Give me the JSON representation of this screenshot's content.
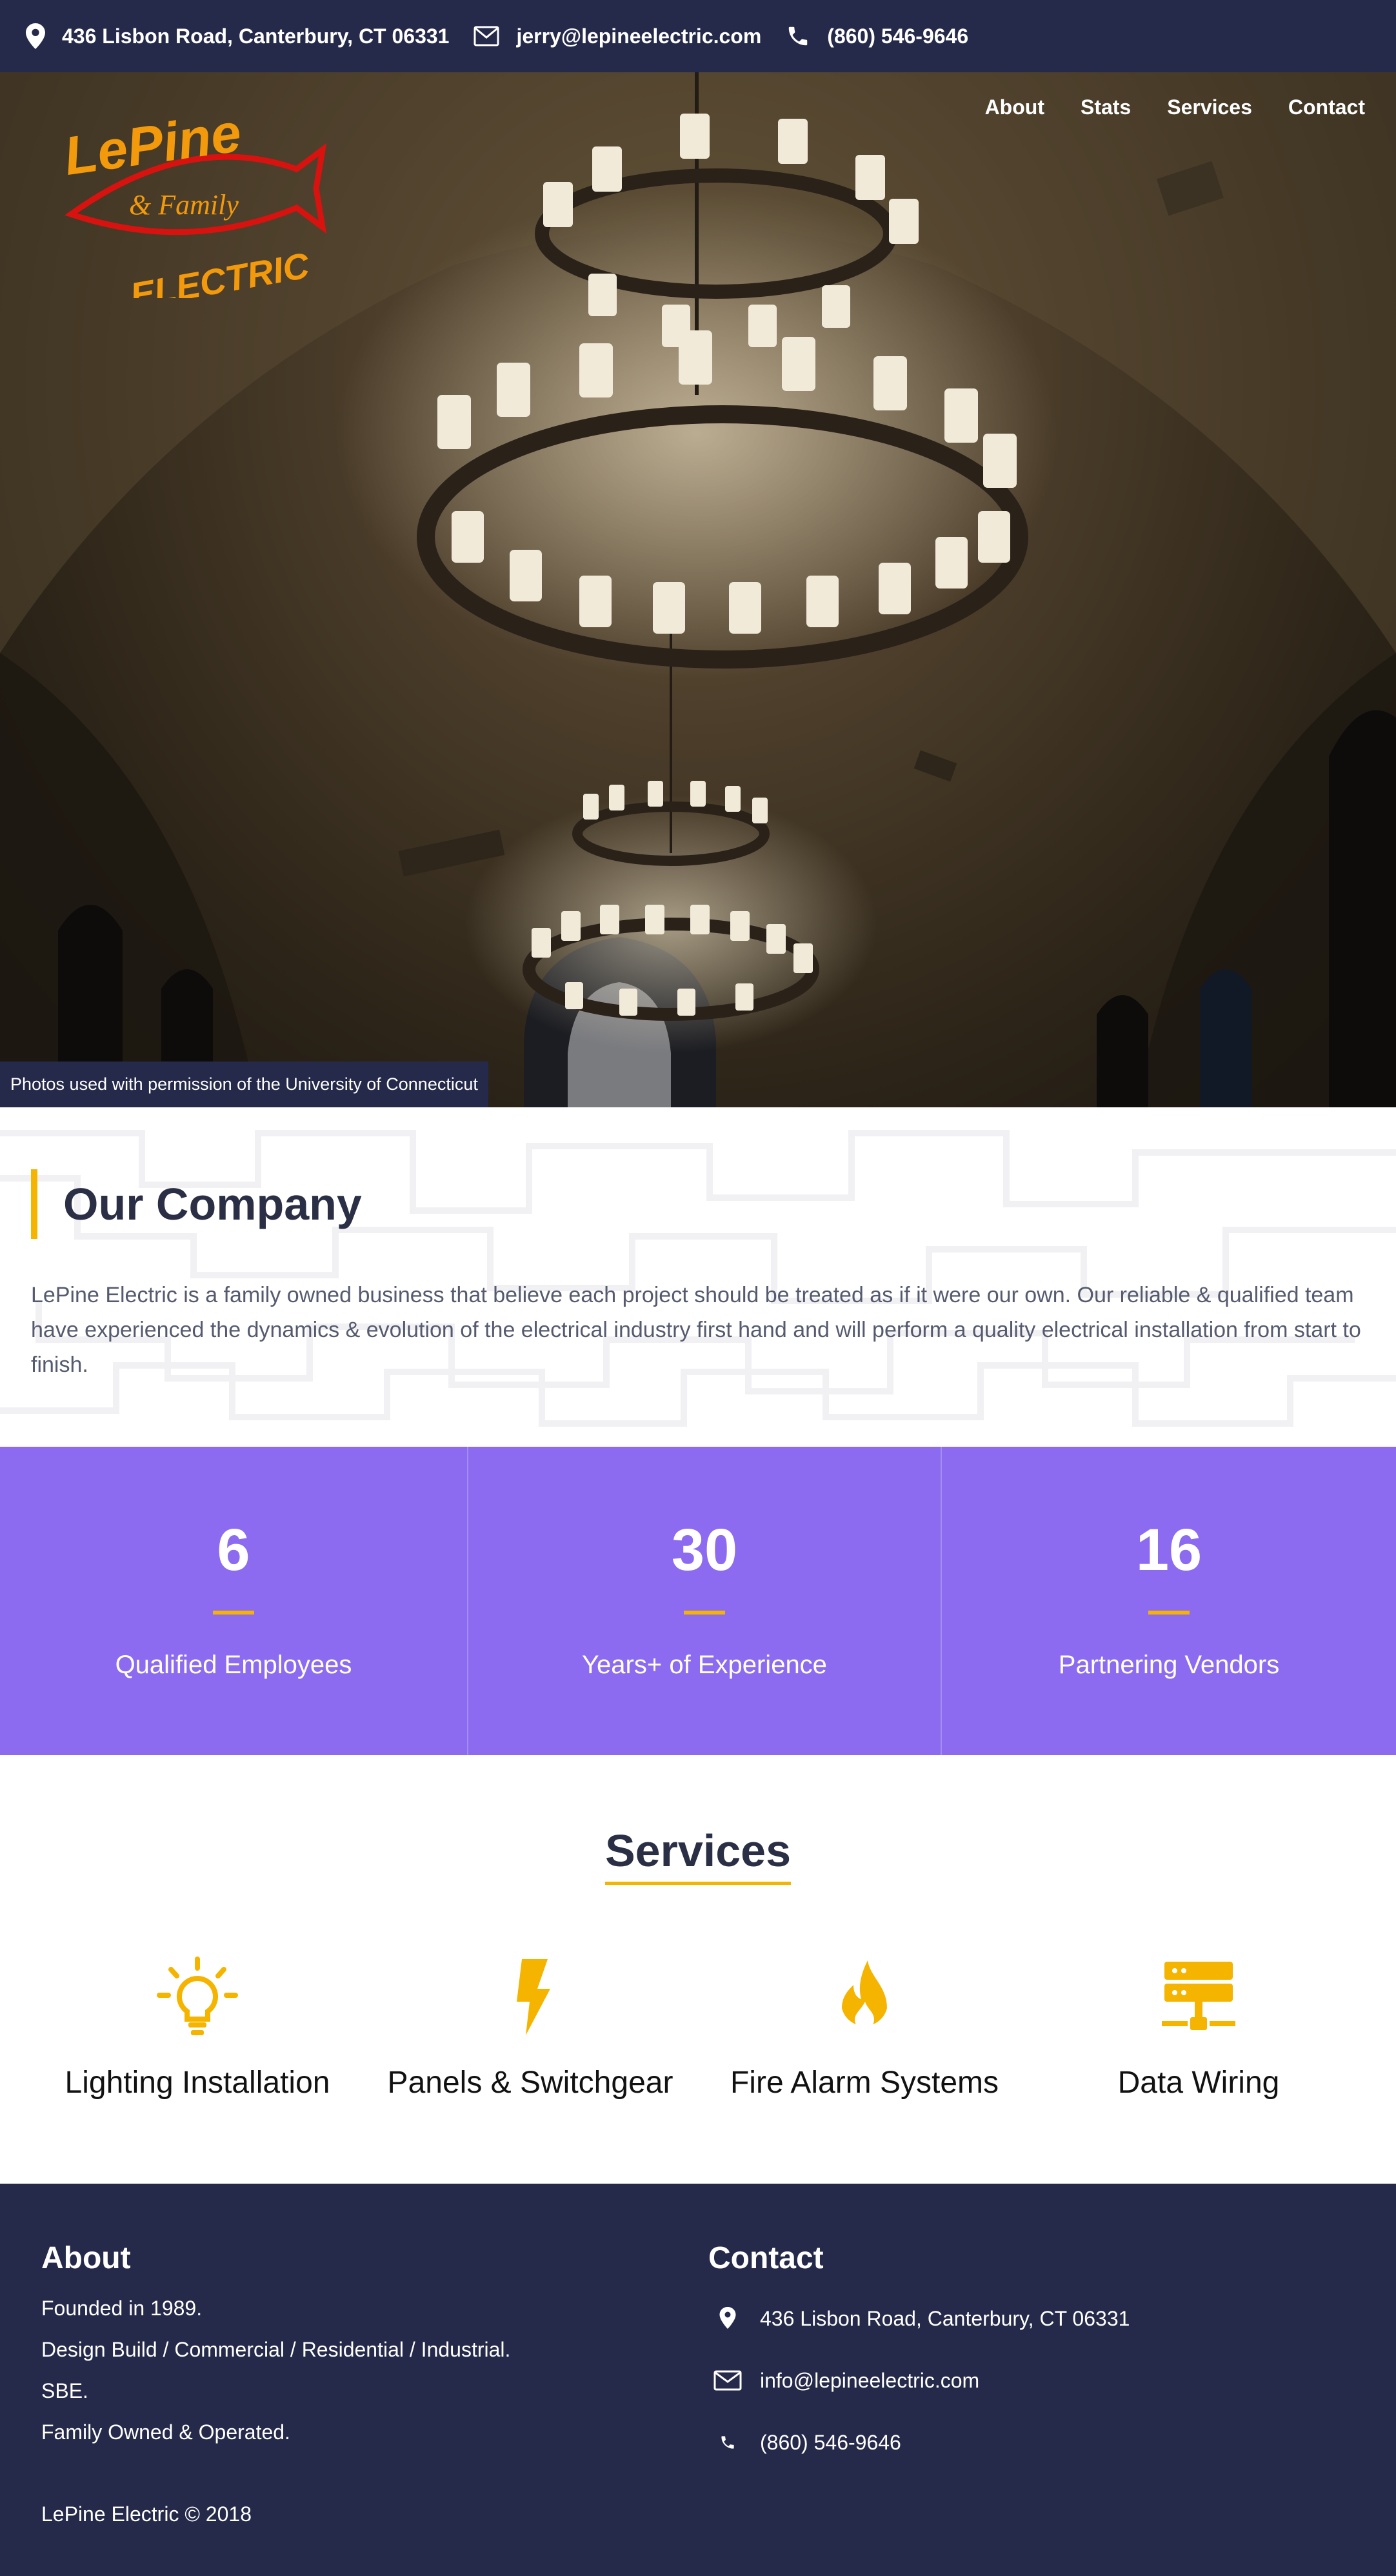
{
  "topbar": {
    "address": "436 Lisbon Road, Canterbury, CT 06331",
    "email": "jerry@lepineelectric.com",
    "phone": "(860) 546-9646"
  },
  "brand": {
    "logo_line1": "LePine",
    "logo_line2": "& Family",
    "logo_line3": "ELECTRIC"
  },
  "nav": {
    "items": [
      {
        "label": "About"
      },
      {
        "label": "Stats"
      },
      {
        "label": "Services"
      },
      {
        "label": "Contact"
      }
    ]
  },
  "hero": {
    "credit": "Photos used with permission of the University of Connecticut"
  },
  "company": {
    "heading": "Our Company",
    "text": "LePine Electric is a family owned business that believe each project should be treated as if it were our own. Our reliable & qualified team have experienced the dynamics & evolution of the electrical industry first hand and will perform a quality electrical installation from start to finish."
  },
  "stats": [
    {
      "value": "6",
      "label": "Qualified Employees"
    },
    {
      "value": "30",
      "label": "Years+ of Experience"
    },
    {
      "value": "16",
      "label": "Partnering Vendors"
    }
  ],
  "services": {
    "title": "Services",
    "items": [
      {
        "label": "Lighting Installation",
        "icon": "lightbulb-icon"
      },
      {
        "label": "Panels & Switchgear",
        "icon": "lightning-bolt-icon"
      },
      {
        "label": "Fire Alarm Systems",
        "icon": "flame-icon"
      },
      {
        "label": "Data Wiring",
        "icon": "server-icon"
      }
    ]
  },
  "footer": {
    "about_title": "About",
    "about_lines": [
      "Founded in 1989.",
      "Design Build / Commercial / Residential / Industrial.",
      "SBE.",
      "Family Owned & Operated."
    ],
    "contact_title": "Contact",
    "contact_address": "436 Lisbon Road, Canterbury, CT 06331",
    "contact_email": "info@lepineelectric.com",
    "contact_phone": "(860) 546-9646",
    "copyright": "LePine Electric © 2018"
  },
  "colors": {
    "navy": "#262a4a",
    "accent": "#f5b400",
    "purple": "#8c6bf0"
  }
}
